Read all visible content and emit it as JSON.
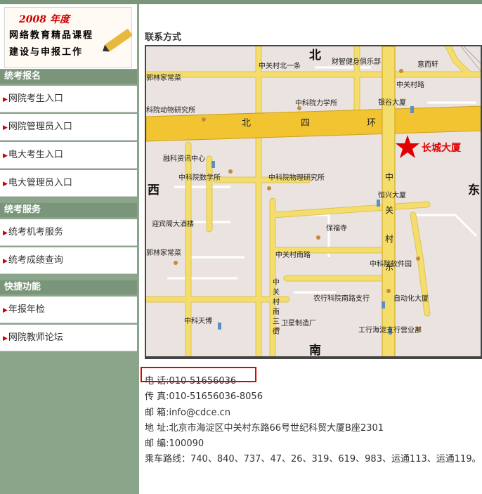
{
  "banner": {
    "year": "2008 年度",
    "line1": "网络教育精品课程",
    "line2": "建设与申报工作"
  },
  "sidebar": {
    "sections": [
      {
        "title": "统考报名",
        "items": [
          "网院考生入口",
          "网院管理员入口",
          "电大考生入口",
          "电大管理员入口"
        ]
      },
      {
        "title": "统考服务",
        "items": [
          "统考机考服务",
          "统考成绩查询"
        ]
      },
      {
        "title": "快捷功能",
        "items": [
          "年报年检",
          "网院教师论坛"
        ]
      }
    ]
  },
  "main": {
    "title": "联系方式"
  },
  "map": {
    "directions": {
      "north": "北",
      "south": "南",
      "west": "西",
      "east": "东"
    },
    "roads": {
      "ring4_1": "北",
      "ring4_2": "四",
      "ring4_3": "环",
      "zgc_east": [
        "中",
        "关",
        "村",
        "东"
      ],
      "zgc_south_road": "中关村南路",
      "zgc_north1": "中关村北一条",
      "zgc_south3": [
        "中",
        "关",
        "村",
        "南",
        "三",
        "街"
      ],
      "zgc_road": "中关村路"
    },
    "places": [
      "财智健身俱乐部",
      "意而轩",
      "郭林家常菜",
      "中科院力学所",
      "银谷大厦",
      "科院动物研究所",
      "融科资讯中心",
      "中科院数学所",
      "中科院物理研究所",
      "恒兴大厦",
      "迎宾阁大酒楼",
      "保福寺",
      "郭林家常菜",
      "中科院软件园",
      "农行科院南路支行",
      "自动化大厦",
      "中科天博",
      "卫星制造厂",
      "工行海淀支行营业部"
    ],
    "target": "长城大厦"
  },
  "contact": {
    "phone": "电 话:010-51656036",
    "fax": "传 真:010-51656036-8056",
    "email": "邮 箱:info@cdce.cn",
    "address": "地 址:北京市海淀区中关村东路66号世纪科贸大厦B座2301",
    "postcode": "邮 编:100090",
    "bus": "乘车路线：740、840、737、47、26、319、619、983、运通113、运通119。"
  },
  "colors": {
    "sidebar": "#8aa58a",
    "section": "#7a957a",
    "highlight": "#e00000",
    "road": "#f5dd6b",
    "ring": "#f2c431"
  }
}
